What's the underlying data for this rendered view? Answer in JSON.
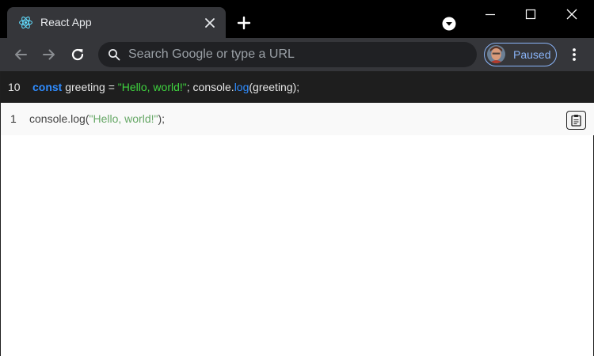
{
  "window": {
    "tab_title": "React App"
  },
  "toolbar": {
    "omnibox_placeholder": "Search Google or type a URL",
    "profile_status": "Paused"
  },
  "icons": {
    "favicon": "react-logo-icon",
    "tab_close": "close-icon",
    "new_tab": "plus-icon",
    "tab_search": "chevron-down-circle-icon",
    "minimize": "minimize-icon",
    "maximize": "maximize-icon",
    "close_window": "close-icon",
    "back": "arrow-left-icon",
    "forward": "arrow-right-icon",
    "reload": "reload-icon",
    "search": "search-icon",
    "menu": "kebab-menu-icon",
    "copy": "clipboard-icon"
  },
  "colors": {
    "keyword": "#2f8cff",
    "string_dark": "#3fd43f",
    "string_light": "#67a867",
    "profile_accent": "#8ab4f8"
  },
  "editor": {
    "line_number": "10",
    "tokens": {
      "kw_const": "const",
      "ident_greeting": " greeting = ",
      "string_hello": "\"Hello, world!\"",
      "mid": "; console.",
      "fn_log": "log",
      "tail": "(greeting);"
    }
  },
  "output": {
    "line_number": "1",
    "tokens": {
      "prefix": "console.log(",
      "string_hello": "\"Hello, world!\"",
      "suffix": ");"
    }
  }
}
